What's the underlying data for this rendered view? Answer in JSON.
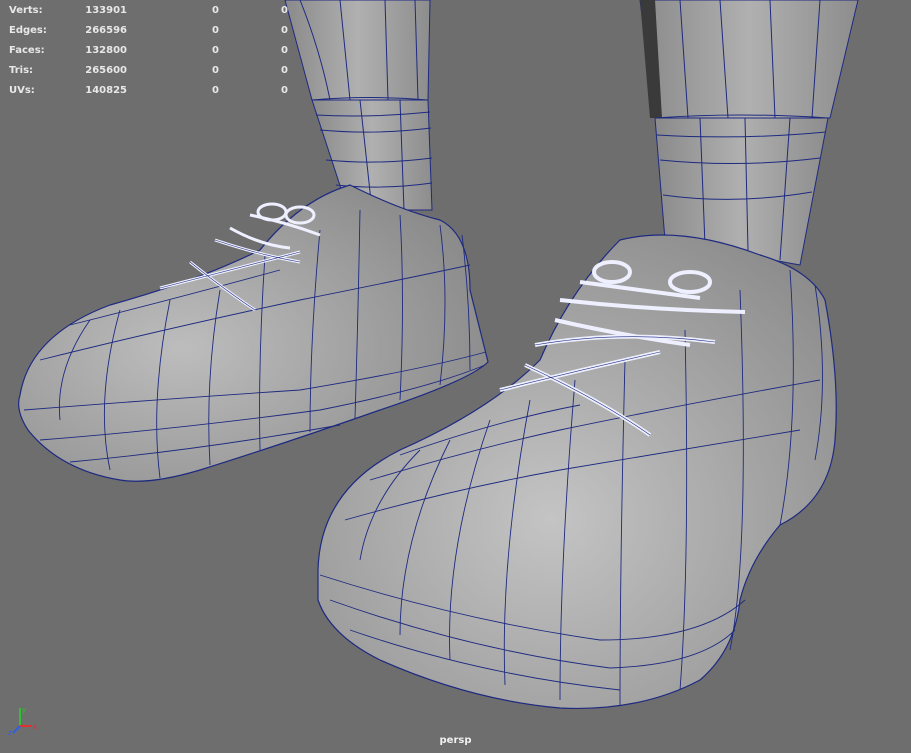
{
  "viewport": {
    "camera": "persp",
    "background": "#6e6e6e",
    "wireframe_color": "#1e2a80",
    "mesh_color": "#a9a9a9"
  },
  "heads_up_display": {
    "rows": [
      {
        "label": "Verts:",
        "total": "133901",
        "selected": "0",
        "component": "0"
      },
      {
        "label": "Edges:",
        "total": "266596",
        "selected": "0",
        "component": "0"
      },
      {
        "label": "Faces:",
        "total": "132800",
        "selected": "0",
        "component": "0"
      },
      {
        "label": "Tris:",
        "total": "265600",
        "selected": "0",
        "component": "0"
      },
      {
        "label": "UVs:",
        "total": "140825",
        "selected": "0",
        "component": "0"
      }
    ]
  },
  "axis_gizmo": {
    "x_label": "x",
    "y_label": "y",
    "z_label": "z",
    "x_color": "#e03030",
    "y_color": "#30c030",
    "z_color": "#3060e0"
  }
}
